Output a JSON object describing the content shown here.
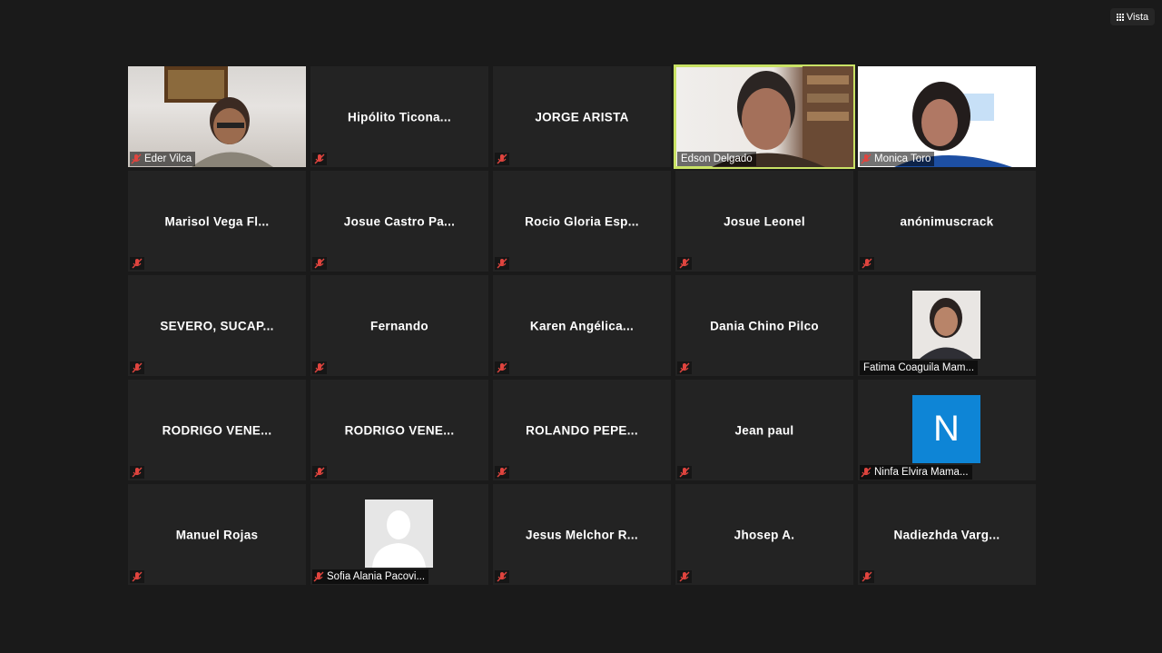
{
  "toolbar": {
    "view_label": "Vista",
    "view_icon": "grid-icon"
  },
  "colors": {
    "active_speaker_border": "#c9e265",
    "muted_icon": "#e0443e",
    "avatar_blue": "#0e85d6"
  },
  "participants": [
    {
      "name": "Eder Vilca",
      "tile": "video"
    },
    {
      "name": "Hipólito  Ticona...",
      "tile": "name"
    },
    {
      "name": "JORGE ARISTA",
      "tile": "name"
    },
    {
      "name": "Edson Delgado",
      "tile": "video",
      "active": true
    },
    {
      "name": "Monica Toro",
      "tile": "video"
    },
    {
      "name": "Marisol Vega Fl...",
      "tile": "name"
    },
    {
      "name": "Josue Castro Pa...",
      "tile": "name"
    },
    {
      "name": "Rocio Gloria Esp...",
      "tile": "name"
    },
    {
      "name": "Josue Leonel",
      "tile": "name"
    },
    {
      "name": "anónimuscrack",
      "tile": "name"
    },
    {
      "name": "SEVERO,  SUCAP...",
      "tile": "name"
    },
    {
      "name": "Fernando",
      "tile": "name"
    },
    {
      "name": "Karen  Angélica...",
      "tile": "name"
    },
    {
      "name": "Dania Chino Pilco",
      "tile": "name"
    },
    {
      "name": "Fatima Coaguila Mam...",
      "tile": "photo"
    },
    {
      "name": "RODRIGO  VENE...",
      "tile": "name"
    },
    {
      "name": "RODRIGO  VENE...",
      "tile": "name"
    },
    {
      "name": "ROLANDO  PEPE...",
      "tile": "name"
    },
    {
      "name": "Jean paul",
      "tile": "name"
    },
    {
      "name": "Ninfa Elvira Mama...",
      "tile": "letter",
      "letter": "N"
    },
    {
      "name": "Manuel Rojas",
      "tile": "name"
    },
    {
      "name": "Sofia Alania Pacovi...",
      "tile": "default-avatar"
    },
    {
      "name": "Jesus  Melchor  R...",
      "tile": "name"
    },
    {
      "name": "Jhosep A.",
      "tile": "name"
    },
    {
      "name": "Nadiezhda  Varg...",
      "tile": "name"
    }
  ]
}
